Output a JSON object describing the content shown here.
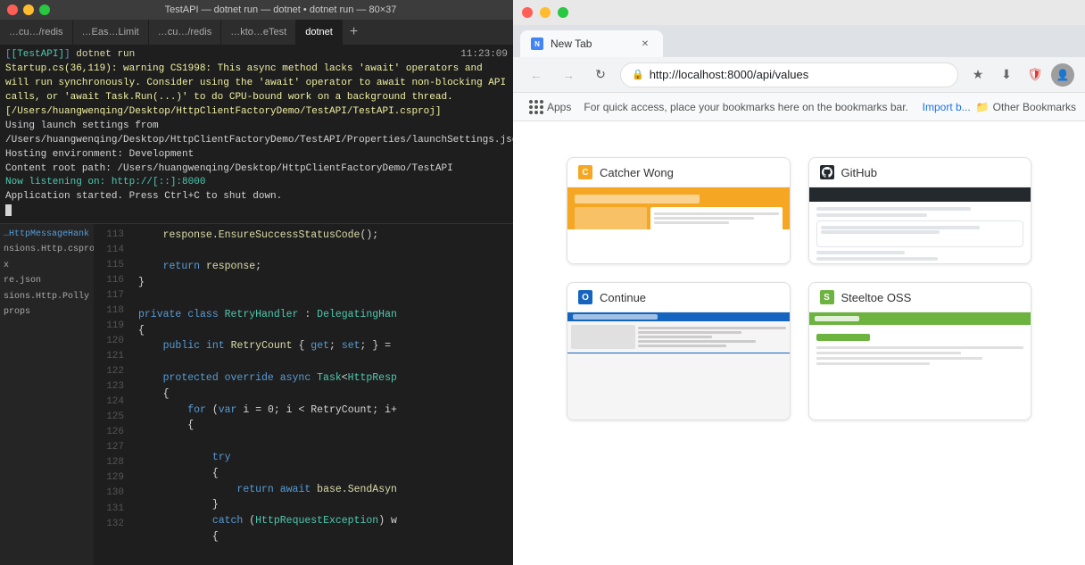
{
  "left": {
    "titlebar": {
      "title": "TestAPI — dotnet run — dotnet  •  dotnet run — 80×37"
    },
    "tabs": [
      {
        "label": "…cu…/redis",
        "active": false
      },
      {
        "label": "…Eas…Limit",
        "active": false
      },
      {
        "label": "…cu…/redis",
        "active": false
      },
      {
        "label": "…kto…eTest",
        "active": false
      },
      {
        "label": "dotnet",
        "active": true
      }
    ],
    "terminal": {
      "line1_prefix": "[TestAPI]",
      "line1_cmd": "dotnet run",
      "line1_time": "11:23:09",
      "line2": "Startup.cs(36,119): warning CS1998: This async method lacks 'await' operators and will run synchronously. Consider using the 'await' operator to await non-blocking API calls, or 'await Task.Run(...)' to do CPU-bound work on a background thread. [/Users/huangwenqing/Desktop/HttpClientFactoryDemo/TestAPI/TestAPI.csproj]",
      "line3": "Using launch settings from /Users/huangwenqing/Desktop/HttpClientFactoryDemo/TestAPI/Properties/launchSettings.json...",
      "line4": "Hosting environment: Development",
      "line5": "Content root path: /Users/huangwenqing/Desktop/HttpClientFactoryDemo/TestAPI",
      "line6": "Now listening on: http://[::]:8000",
      "line7": "Application started. Press Ctrl+C to shut down."
    },
    "code": {
      "lines": [
        {
          "num": "113",
          "text": "response.EnsureSuccessStatusCode();"
        },
        {
          "num": "114",
          "text": ""
        },
        {
          "num": "115",
          "text": "    return response;"
        },
        {
          "num": "116",
          "text": "}"
        },
        {
          "num": "117",
          "text": ""
        },
        {
          "num": "118",
          "text": "private class RetryHandler : DelegatingHan"
        },
        {
          "num": "119",
          "text": "{"
        },
        {
          "num": "120",
          "text": "    public int RetryCount { get; set; } ="
        },
        {
          "num": "121",
          "text": ""
        },
        {
          "num": "122",
          "text": "    protected override async Task<HttpResp"
        },
        {
          "num": "123",
          "text": "    {"
        },
        {
          "num": "124",
          "text": "        for (var i = 0; i < RetryCount; i+"
        },
        {
          "num": "125",
          "text": "        {"
        },
        {
          "num": "126",
          "text": ""
        },
        {
          "num": "127",
          "text": "            try"
        },
        {
          "num": "128",
          "text": "            {"
        },
        {
          "num": "129",
          "text": "                return await base.SendAsyn"
        },
        {
          "num": "130",
          "text": "            }"
        },
        {
          "num": "131",
          "text": "            catch (HttpRequestException) w"
        },
        {
          "num": "132",
          "text": "            {"
        }
      ],
      "sidebar_items": [
        {
          "text": "…HttpMessageHank"
        },
        {
          "text": "nsions.Http.csproj"
        },
        {
          "text": "x"
        },
        {
          "text": "re.json"
        },
        {
          "text": "sions.Http.Polly"
        },
        {
          "text": "props"
        }
      ]
    }
  },
  "right": {
    "titlebar": {
      "buttons": [
        "close",
        "minimize",
        "maximize"
      ]
    },
    "tab": {
      "label": "New Tab",
      "favicon": "N"
    },
    "toolbar": {
      "back_disabled": true,
      "forward_disabled": true,
      "url": "http://localhost:8000/api/values"
    },
    "bookmarks_bar": {
      "apps_label": "Apps",
      "hint": "For quick access, place your bookmarks here on the bookmarks bar.",
      "import_label": "Import b...",
      "other_label": "Other Bookmarks"
    },
    "bookmarks": [
      {
        "title": "Catcher Wong",
        "favicon_text": "C",
        "favicon_bg": "#f5a623",
        "preview_type": "catcher"
      },
      {
        "title": "GitHub",
        "favicon_text": "G",
        "favicon_bg": "#24292e",
        "preview_type": "github"
      },
      {
        "title": "Continue",
        "favicon_text": "O",
        "favicon_bg": "#1565c0",
        "preview_type": "continue"
      },
      {
        "title": "Steeltoe OSS",
        "favicon_text": "S",
        "favicon_bg": "#6db33f",
        "preview_type": "steeltoe"
      }
    ]
  }
}
